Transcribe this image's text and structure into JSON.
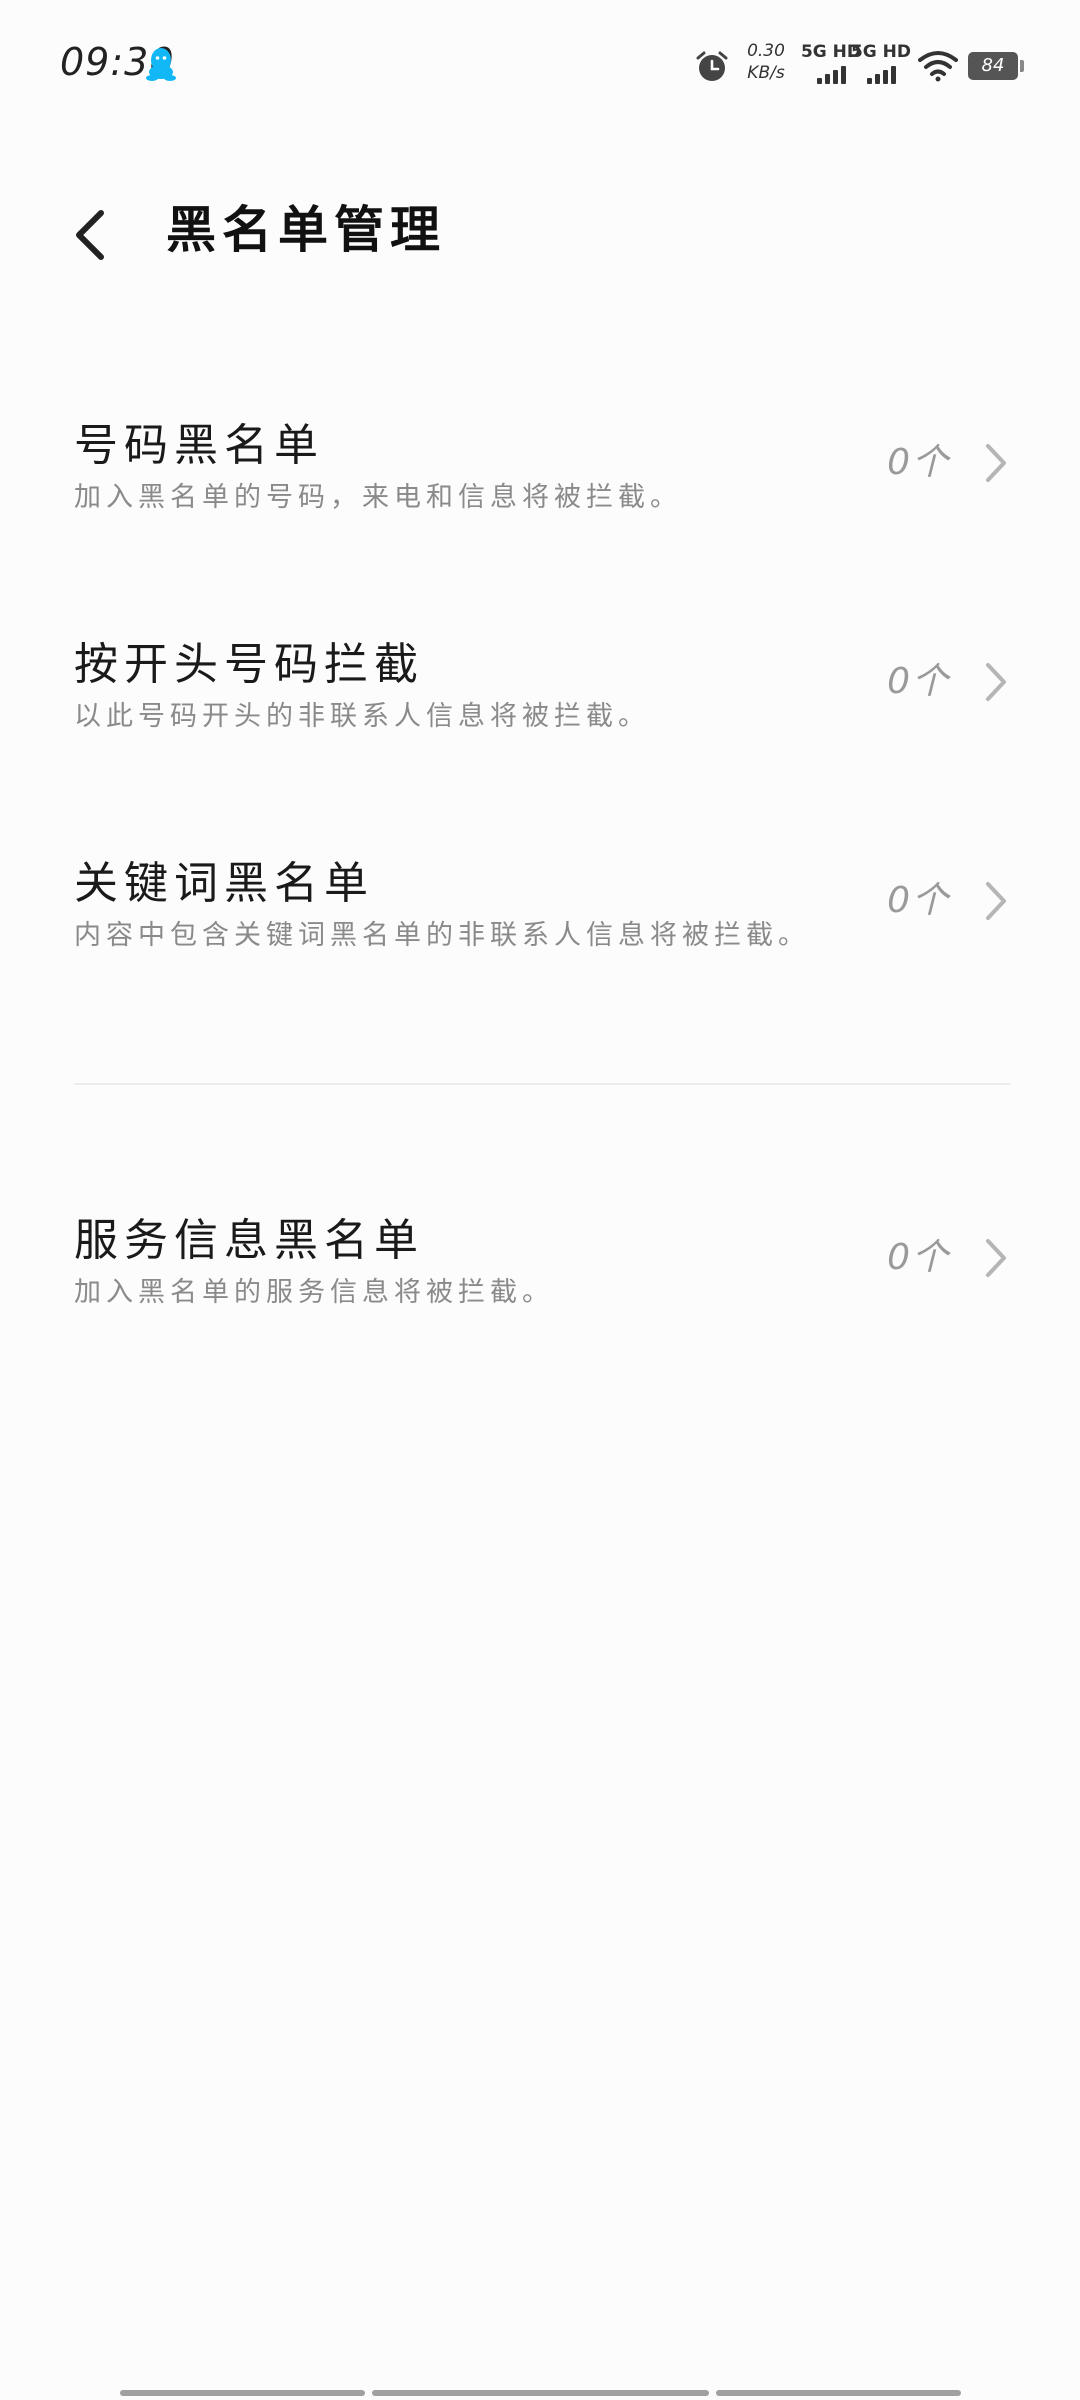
{
  "status_bar": {
    "time": "09:30",
    "net_speed_value": "0.30",
    "net_speed_unit": "KB/s",
    "signal_1_label": "5G HD",
    "signal_2_label": "5G HD",
    "battery": "84",
    "icons": [
      "qq-icon",
      "alarm-icon",
      "wifi-icon",
      "battery-icon"
    ],
    "qq_color": "#12b7f5"
  },
  "header": {
    "title": "黑名单管理",
    "back_icon": "chevron-left-icon"
  },
  "items": [
    {
      "title": "号码黑名单",
      "description": "加入黑名单的号码，来电和信息将被拦截。",
      "count": "0个"
    },
    {
      "title": "按开头号码拦截",
      "description": "以此号码开头的非联系人信息将被拦截。",
      "count": "0个"
    },
    {
      "title": "关键词黑名单",
      "description": "内容中包含关键词黑名单的非联系人信息将被拦截。",
      "count": "0个"
    },
    {
      "title": "服务信息黑名单",
      "description": "加入黑名单的服务信息将被拦截。",
      "count": "0个"
    }
  ]
}
